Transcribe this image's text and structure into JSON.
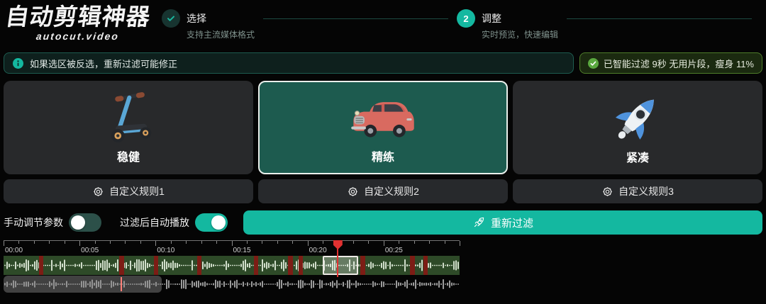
{
  "app": {
    "title": "自动剪辑神器",
    "subtitle": "autocut.video"
  },
  "steps": {
    "step1": {
      "label": "选择",
      "sublabel": "支持主流媒体格式",
      "state": "completed",
      "icon": "check-icon"
    },
    "step2": {
      "label": "调整",
      "sublabel": "实时预览，快速编辑",
      "number": "2",
      "state": "active"
    }
  },
  "notice": {
    "icon": "info-icon",
    "text": "如果选区被反选，重新过滤可能修正"
  },
  "status_badge": {
    "icon": "check-icon",
    "text": "已智能过滤 9秒 无用片段，瘦身 11%"
  },
  "presets": {
    "items": [
      {
        "label": "稳健",
        "icon": "scooter-icon",
        "selected": false
      },
      {
        "label": "精练",
        "icon": "car-icon",
        "selected": true
      },
      {
        "label": "紧凑",
        "icon": "rocket-icon",
        "selected": false
      }
    ]
  },
  "rules": {
    "icon": "gear-icon",
    "items": [
      {
        "label": "自定义规则1"
      },
      {
        "label": "自定义规则2"
      },
      {
        "label": "自定义规则3"
      }
    ]
  },
  "controls": {
    "manual": {
      "label": "手动调节参数",
      "on": false
    },
    "autoplay": {
      "label": "过滤后自动播放",
      "on": true
    },
    "refilter": {
      "label": "重新过滤",
      "icon": "rocket-outline-icon"
    }
  },
  "colors": {
    "accent": "#14b8a0",
    "accent_dark": "#1d5b4f",
    "toggle_off": "#2c5049",
    "card_bg": "#28292b",
    "wave_bg": "#2e4a28",
    "cut_red": "#7c1d15",
    "playhead_red": "#e03131",
    "overview_playhead": "#ff8078",
    "status_green": "#5aa83f"
  },
  "timeline": {
    "duration_sec": 30,
    "minor_tick_sec": 1,
    "major_tick_sec": 5,
    "tick_labels": [
      "00:00",
      "00:05",
      "00:10",
      "00:15",
      "00:20",
      "00:25"
    ],
    "cut_segments_pct": [
      [
        7.8,
        0.95
      ],
      [
        25.4,
        1.1
      ],
      [
        33.0,
        0.95
      ],
      [
        42.5,
        0.95
      ],
      [
        54.9,
        0.95
      ],
      [
        62.4,
        1.1
      ],
      [
        64.7,
        0.95
      ],
      [
        78.2,
        1.1
      ],
      [
        89.1,
        1.1
      ],
      [
        92.1,
        0.95
      ]
    ],
    "selection_pct": {
      "start": 70.0,
      "width": 7.8
    },
    "playhead_pct": 73.3,
    "overview_selection_pct": {
      "start": 0,
      "width": 34.7
    },
    "overview_playhead_pct": 25.7
  }
}
